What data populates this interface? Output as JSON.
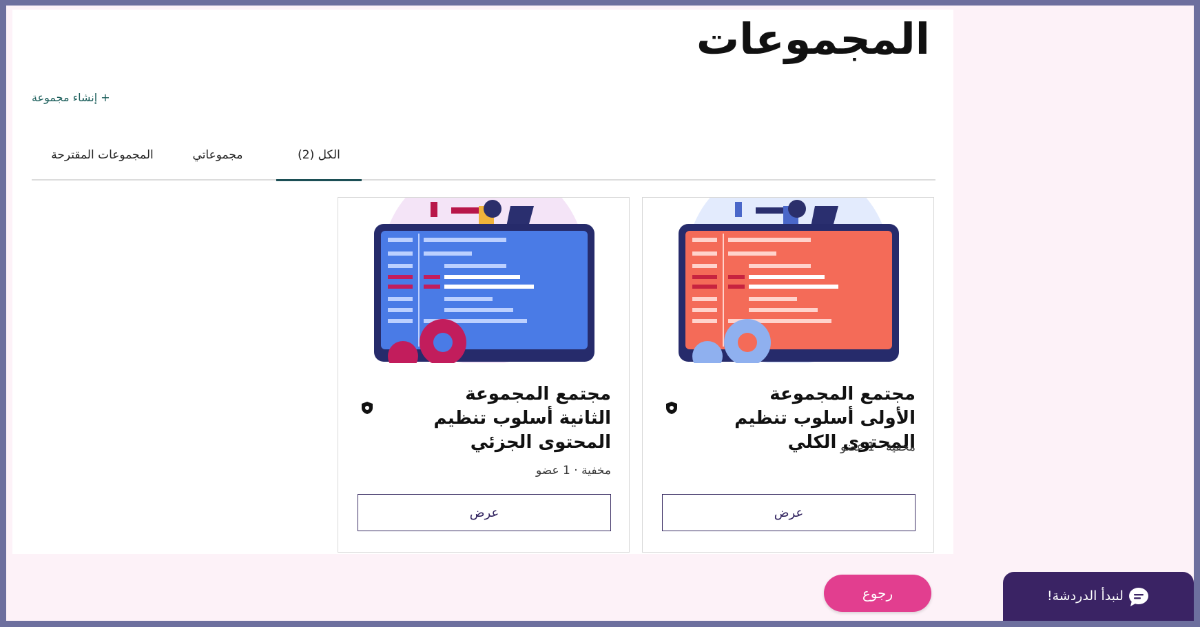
{
  "page": {
    "title": "المجموعات"
  },
  "actions": {
    "create_group": "+ إنشاء مجموعة"
  },
  "tabs": [
    {
      "label": "الكل (2)",
      "active": true
    },
    {
      "label": "مجموعاتي",
      "active": false
    },
    {
      "label": "المجموعات المقترحة",
      "active": false
    }
  ],
  "cards": [
    {
      "title": "مجتمع المجموعة الأولى أسلوب تنظيم المحتوى الكلي",
      "meta": "مخفية · 1 عضو",
      "view_label": "عرض",
      "screen_color": "#f46b58",
      "gear_color": "#8fb0ef",
      "icon": "shield-icon"
    },
    {
      "title": "مجتمع المجموعة الثانية أسلوب تنظيم المحتوى الجزئي",
      "meta": "مخفية · 1 عضو",
      "view_label": "عرض",
      "screen_color": "#4a7be6",
      "gear_color": "#c21d5c",
      "icon": "shield-icon"
    }
  ],
  "footer": {
    "back_label": "رجوع",
    "chat_label": "لنبدأ الدردشة!",
    "chat_icon": "chat-bubble-icon"
  },
  "colors": {
    "accent_pink": "#e23e8f",
    "chat_bg": "#3a2364",
    "tab_underline": "#1c4f55",
    "frame": "#6d6f9e"
  }
}
